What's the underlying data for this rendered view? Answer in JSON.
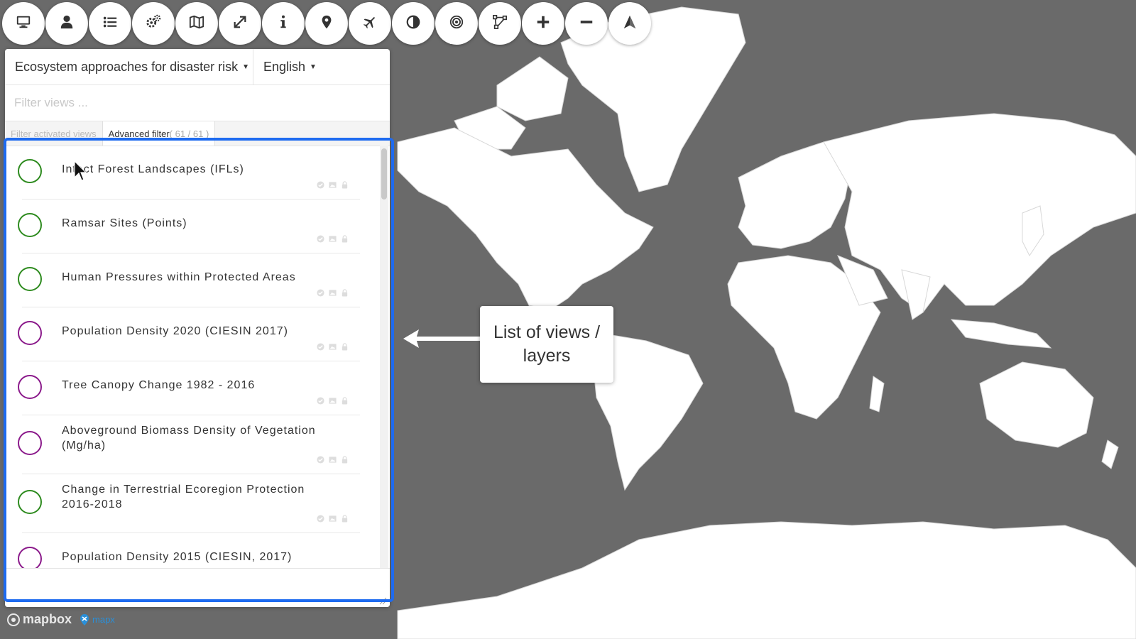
{
  "toolbar": {
    "buttons": [
      {
        "icon": "desktop-icon"
      },
      {
        "icon": "user-icon"
      },
      {
        "icon": "list-icon"
      },
      {
        "icon": "gears-icon"
      },
      {
        "icon": "map-icon"
      },
      {
        "icon": "expand-icon"
      },
      {
        "icon": "info-icon"
      },
      {
        "icon": "map-marker-icon"
      },
      {
        "icon": "plane-icon"
      },
      {
        "icon": "contrast-icon"
      },
      {
        "icon": "target-icon"
      },
      {
        "icon": "draw-polygon-icon"
      },
      {
        "icon": "plus-icon"
      },
      {
        "icon": "minus-icon"
      },
      {
        "icon": "north-arrow-icon"
      }
    ]
  },
  "panel": {
    "project_label": "Ecosystem approaches for disaster risk",
    "language_label": "English",
    "filter_placeholder": "Filter views ...",
    "filter_tabs": {
      "activated": "Filter activated views",
      "advanced": "Advanced filter",
      "advanced_count": "( 61 / 61 )"
    },
    "views": [
      {
        "title": "Intact Forest Landscapes (IFLs)",
        "color": "#2e8b1f"
      },
      {
        "title": "Ramsar Sites (Points)",
        "color": "#2e8b1f"
      },
      {
        "title": "Human Pressures within Protected Areas",
        "color": "#2e8b1f"
      },
      {
        "title": "Population Density 2020 (CIESIN 2017)",
        "color": "#8b1a8b"
      },
      {
        "title": "Tree Canopy Change 1982 - 2016",
        "color": "#8b1a8b"
      },
      {
        "title": "Aboveground Biomass Density of Vegetation (Mg/ha)",
        "color": "#8b1a8b"
      },
      {
        "title": "Change in Terrestrial Ecoregion Protection 2016-2018",
        "color": "#2e8b1f"
      },
      {
        "title": "Population Density 2015 (CIESIN, 2017)",
        "color": "#8b1a8b"
      }
    ]
  },
  "callout": {
    "line1": "List of views /",
    "line2": "layers"
  },
  "attribution": {
    "mapbox": "mapbox",
    "mapx": "mapx"
  },
  "colors": {
    "ocean": "#6a6a6a",
    "land": "#ffffff",
    "highlight": "#1e6bf0",
    "green": "#2e8b1f",
    "purple": "#8b1a8b"
  }
}
